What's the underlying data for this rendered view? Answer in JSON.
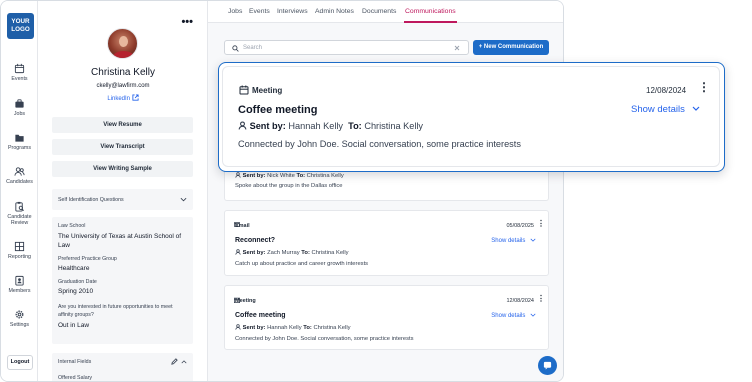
{
  "logo": {
    "line1": "YOUR",
    "line2": "LOGO"
  },
  "nav": {
    "items": [
      {
        "label": "Events",
        "icon": "calendar-icon"
      },
      {
        "label": "Jobs",
        "icon": "briefcase-icon"
      },
      {
        "label": "Programs",
        "icon": "folder-icon"
      },
      {
        "label": "Candidates",
        "icon": "users-icon"
      },
      {
        "label": "Candidate",
        "label2": "Review",
        "icon": "clipboard-search-icon"
      },
      {
        "label": "Reporting",
        "icon": "grid-icon"
      },
      {
        "label": "Members",
        "icon": "badge-icon"
      },
      {
        "label": "Settings",
        "icon": "gear-icon"
      }
    ],
    "logout": "Logout"
  },
  "profile": {
    "name": "Christina Kelly",
    "email": "ckelly@lawfirm.com",
    "linkedin": "LinkedIn",
    "buttons": {
      "resume": "View Resume",
      "transcript": "View Transcript",
      "writing": "View Writing Sample"
    },
    "self_id": "Self Identification Questions",
    "fields": [
      {
        "label": "Law School",
        "value": "The University of Texas at Austin School of Law"
      },
      {
        "label": "Preferred Practice Group",
        "value": "Healthcare"
      },
      {
        "label": "Graduation Date",
        "value": "Spring 2010"
      },
      {
        "label": "Are you interested in future opportunities to meet affinity groups?",
        "value": "Out in Law"
      }
    ],
    "internal_fields": "Internal Fields",
    "offered_salary": "Offered Salary"
  },
  "tabs": [
    {
      "label": "Jobs",
      "active": false
    },
    {
      "label": "Events",
      "active": false
    },
    {
      "label": "Interviews",
      "active": false
    },
    {
      "label": "Admin Notes",
      "active": false
    },
    {
      "label": "Documents",
      "active": false
    },
    {
      "label": "Communications",
      "active": true
    }
  ],
  "search": {
    "placeholder": "Search"
  },
  "new_button": "+ New Communication",
  "sent_by_label": "Sent by:",
  "to_label": "To:",
  "cards": [
    {
      "sent_by": "Nick White",
      "to": "Christina Kelly",
      "desc": "Spoke about the group in the Dallas office"
    },
    {
      "type": "Email",
      "date": "05/08/2025",
      "title": "Reconnect?",
      "show": "Show details",
      "sent_by": "Zach Murray",
      "to": "Christina Kelly",
      "desc": "Catch up about practice and career growth interests"
    },
    {
      "type": "Meeting",
      "date": "12/08/2024",
      "title": "Coffee meeting",
      "show": "Show details",
      "sent_by": "Hannah Kelly",
      "to": "Christina Kelly",
      "desc": "Connected by John Doe. Social conversation, some practice interests"
    }
  ],
  "overlay": {
    "type": "Meeting",
    "date": "12/08/2024",
    "title": "Coffee meeting",
    "show": "Show details",
    "sent_by": "Hannah Kelly",
    "to": "Christina Kelly",
    "desc": "Connected by John Doe. Social conversation, some practice interests"
  },
  "colors": {
    "accent": "#1d6cc8",
    "active_tab": "#be185d",
    "link": "#2563eb"
  }
}
